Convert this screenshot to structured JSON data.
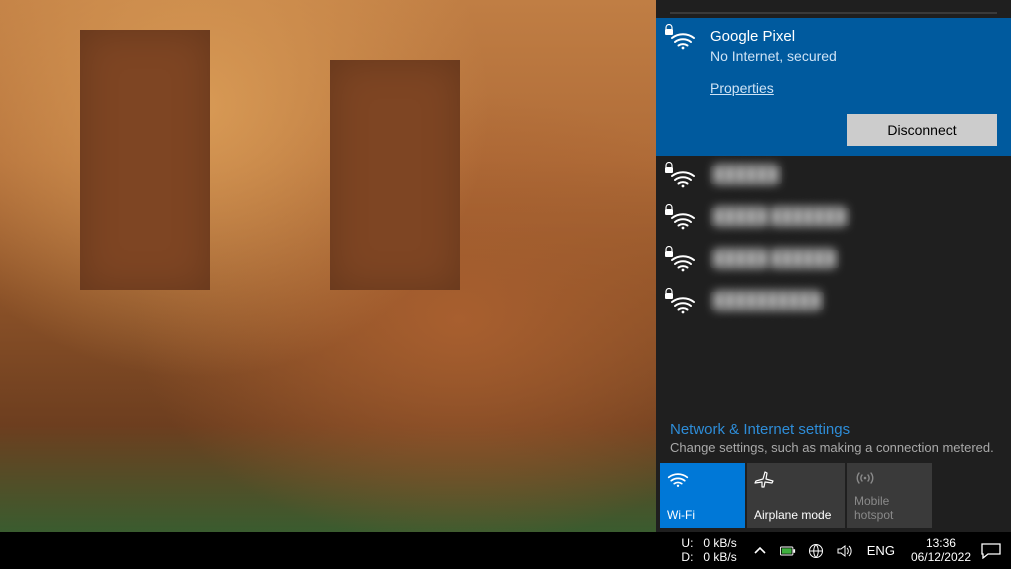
{
  "connected": {
    "name": "Google Pixel",
    "status": "No Internet, secured",
    "properties_label": "Properties",
    "disconnect_label": "Disconnect"
  },
  "other_networks": [
    {
      "name": "██████"
    },
    {
      "name": "█████ ███████"
    },
    {
      "name": "█████ ██████"
    },
    {
      "name": "██████████"
    }
  ],
  "footer": {
    "title": "Network & Internet settings",
    "subtitle": "Change settings, such as making a connection metered."
  },
  "tiles": {
    "wifi": "Wi-Fi",
    "airplane": "Airplane mode",
    "hotspot_line1": "Mobile",
    "hotspot_line2": "hotspot"
  },
  "netmon": {
    "up_label": "U:",
    "up_value": "0 kB/s",
    "down_label": "D:",
    "down_value": "0 kB/s"
  },
  "tray": {
    "language": "ENG",
    "time": "13:36",
    "date": "06/12/2022"
  }
}
